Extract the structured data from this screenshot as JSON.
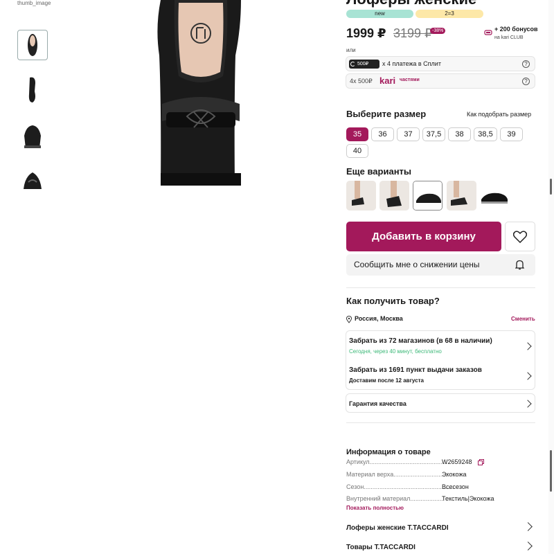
{
  "product": {
    "title": "Лоферы женские",
    "tag_new": "new",
    "tag_promo": "2=3",
    "price": "1999 ₽",
    "old_price": "3199 ₽",
    "discount": "-38%",
    "bonus": "+ 200 бонусов",
    "bonus_sub": "на kari CLUB",
    "or": "или"
  },
  "thumbs": {
    "broken_alt": "thumb_image"
  },
  "payment": {
    "split_badge": "500₽",
    "split_text": "x 4 платежа в Сплит",
    "parts_amount": "4x 500₽",
    "parts_brand": "kari",
    "parts_brand_sub": "частями",
    "help": "?"
  },
  "sizes": {
    "title": "Выберите размер",
    "guide_link": "Как подобрать размер",
    "items": [
      "35",
      "36",
      "37",
      "37,5",
      "38",
      "38,5",
      "39",
      "40"
    ],
    "selected": "35"
  },
  "variants": {
    "title": "Еще варианты"
  },
  "actions": {
    "add_to_cart": "Добавить в корзину",
    "notify_price": "Сообщить мне о снижении цены"
  },
  "delivery": {
    "title": "Как получить товар?",
    "city": "Россия, Москва",
    "change": "Сменить",
    "pickup_title": "Забрать из 72 магазинов (в 68 в наличии)",
    "pickup_sub": "Сегодня, через 40 минут, бесплатно",
    "points_title": "Забрать из 1691 пункт выдачи заказов",
    "points_sub": "Доставим после 12 августа",
    "guarantee": "Гарантия качества"
  },
  "info": {
    "title": "Информация о товаре",
    "rows": [
      {
        "key": "Артикул..............................................",
        "value": "W2659248"
      },
      {
        "key": "Материал верха...............................",
        "value": "Экокожа"
      },
      {
        "key": "Сезон....................................................",
        "value": "Всесезон"
      },
      {
        "key": "Внутренний материал...................",
        "value": "Текстиль|Экокожа"
      }
    ],
    "show_all": "Показать полностью"
  },
  "links": {
    "brand_loafers": "Лоферы женские T.TACCARDI",
    "brand_goods": "Товары T.TACCARDI"
  },
  "colors": {
    "accent": "#a3195b",
    "tag_new": "#a8e3d4",
    "tag_promo": "#fde8a8",
    "success": "#3cb878"
  }
}
